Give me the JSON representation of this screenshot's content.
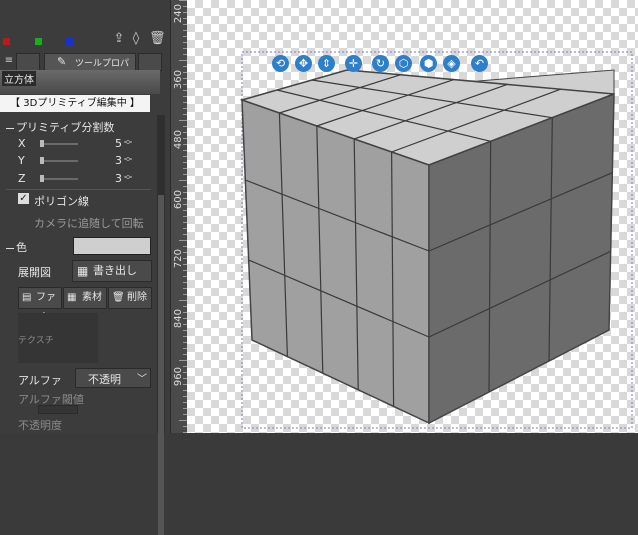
{
  "panel": {
    "tool_property_tab": "ツールプロパテ",
    "object_name": "立方体",
    "mode_banner": "【 3Dプリミティブ編集中 】",
    "primitive_section": "プリミティブ分割数",
    "axes": [
      {
        "label": "X",
        "value": "5",
        "level": 0.05
      },
      {
        "label": "Y",
        "value": "3",
        "level": 0.05
      },
      {
        "label": "Z",
        "value": "3",
        "level": 0.05
      }
    ],
    "polygon_lines_label": "ポリゴン線",
    "polygon_lines_checked": true,
    "rotate_with_camera_label": "カメラに追随して回転",
    "color_section": "色",
    "unfold_label": "展開図",
    "export_button": "書き出し",
    "file_button": "ファイ",
    "material_button": "素材",
    "delete_button": "削除",
    "texture_label": "テクスチ",
    "alpha_label": "アルファ",
    "alpha_value": "不透明",
    "alpha_threshold_label": "アルファ閾値",
    "opacity_label": "不透明度"
  },
  "ruler": {
    "labels": [
      "240",
      "360",
      "480",
      "600",
      "720",
      "840",
      "960"
    ]
  },
  "colors": {
    "panel_bg": "#3c3c3c",
    "accent_blue": "#2f7fc8",
    "cube_top": "#cfcfcf",
    "cube_front": "#9e9e9e",
    "cube_side": "#6a6a6a"
  },
  "gizmo_icons": [
    "camera-rotate-icon",
    "camera-pan-icon",
    "camera-dolly-icon",
    "move-icon",
    "rotate-icon",
    "object-rotate-icon",
    "object-move-icon",
    "scale-icon",
    "reset-icon"
  ]
}
